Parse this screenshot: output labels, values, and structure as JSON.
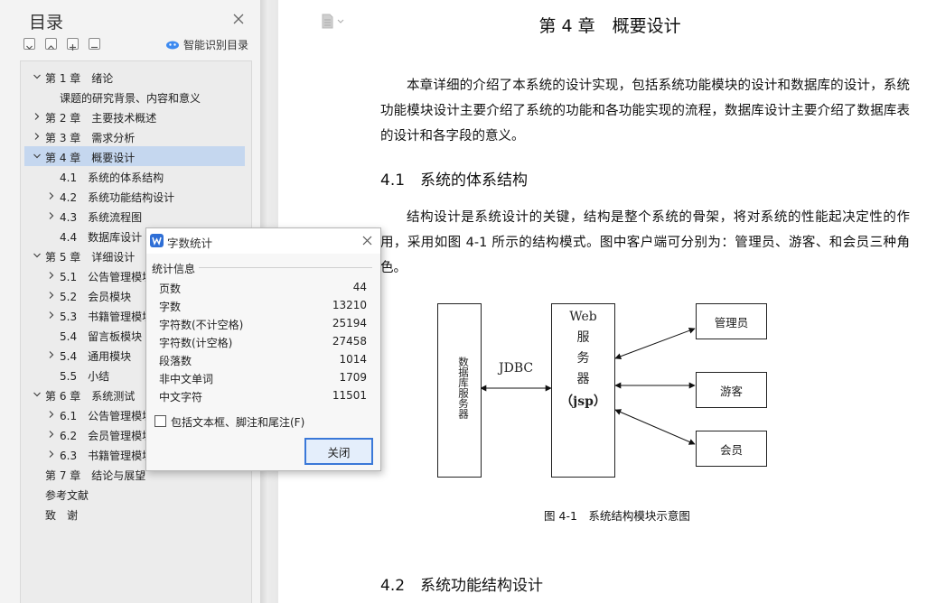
{
  "nav": {
    "title": "目录",
    "smart_toc_label": "智能识别目录",
    "items": [
      {
        "label": "第 1 章　绪论",
        "level": 0,
        "expanded": true
      },
      {
        "label": "课题的研究背景、内容和意义",
        "level": 1,
        "expanded": null
      },
      {
        "label": "第 2 章　主要技术概述",
        "level": 0,
        "expanded": false
      },
      {
        "label": "第 3 章　需求分析",
        "level": 0,
        "expanded": false
      },
      {
        "label": "第 4 章　概要设计",
        "level": 0,
        "expanded": true,
        "active": true
      },
      {
        "label": "4.1　系统的体系结构",
        "level": 1,
        "expanded": null
      },
      {
        "label": "4.2　系统功能结构设计",
        "level": 1,
        "expanded": false
      },
      {
        "label": "4.3　系统流程图",
        "level": 1,
        "expanded": false
      },
      {
        "label": "4.4　数据库设计",
        "level": 1,
        "expanded": null
      },
      {
        "label": "第 5 章　详细设计",
        "level": 0,
        "expanded": true
      },
      {
        "label": "5.1　公告管理模块",
        "level": 1,
        "expanded": false
      },
      {
        "label": "5.2　会员模块",
        "level": 1,
        "expanded": false
      },
      {
        "label": "5.3　书籍管理模块",
        "level": 1,
        "expanded": false
      },
      {
        "label": "5.4　留言板模块",
        "level": 1,
        "expanded": null
      },
      {
        "label": "5.4　通用模块",
        "level": 1,
        "expanded": false
      },
      {
        "label": "5.5　小结",
        "level": 1,
        "expanded": null
      },
      {
        "label": "第 6 章　系统测试",
        "level": 0,
        "expanded": true
      },
      {
        "label": "6.1　公告管理模块",
        "level": 1,
        "expanded": false
      },
      {
        "label": "6.2　会员管理模块",
        "level": 1,
        "expanded": false
      },
      {
        "label": "6.3　书籍管理模块",
        "level": 1,
        "expanded": false
      },
      {
        "label": "第 7 章　结论与展望",
        "level": 0,
        "expanded": null
      },
      {
        "label": "参考文献",
        "level": 0,
        "expanded": null
      },
      {
        "label": "致　谢",
        "level": 0,
        "expanded": null
      }
    ]
  },
  "doc": {
    "chapter_title": "第 4 章　概要设计",
    "intro": "本章详细的介绍了本系统的设计实现，包括系统功能模块的设计和数据库的设计，系统功能模块设计主要介绍了系统的功能和各功能实现的流程，数据库设计主要介绍了数据库表的设计和各字段的意义。",
    "section_41": "4.1　系统的体系结构",
    "para_41": "结构设计是系统设计的关键，结构是整个系统的骨架，将对系统的性能起决定性的作用，采用如图 4-1 所示的结构模式。图中客户端可分别为：管理员、游客、和会员三种角色。",
    "diagram": {
      "db_server": "数据库服务器",
      "jdbc": "JDBC",
      "web_server_lines": [
        "Web",
        "服",
        "务",
        "器"
      ],
      "jsp": "（jsp）",
      "roles": [
        "管理员",
        "游客",
        "会员"
      ]
    },
    "figure_caption": "图 4-1　系统结构模块示意图",
    "section_42": "4.2　系统功能结构设计"
  },
  "dialog": {
    "title": "字数统计",
    "group_label": "统计信息",
    "stats": [
      {
        "label": "页数",
        "value": "44"
      },
      {
        "label": "字数",
        "value": "13210"
      },
      {
        "label": "字符数(不计空格)",
        "value": "25194"
      },
      {
        "label": "字符数(计空格)",
        "value": "27458"
      },
      {
        "label": "段落数",
        "value": "1014"
      },
      {
        "label": "非中文单词",
        "value": "1709"
      },
      {
        "label": "中文字符",
        "value": "11501"
      }
    ],
    "checkbox_label": "包括文本框、脚注和尾注(F)",
    "checkbox_checked": false,
    "close_button": "关闭"
  },
  "colors": {
    "active_item": "#c5d7ef",
    "accent": "#3a78d8",
    "app_logo": "#2f6fd6"
  }
}
